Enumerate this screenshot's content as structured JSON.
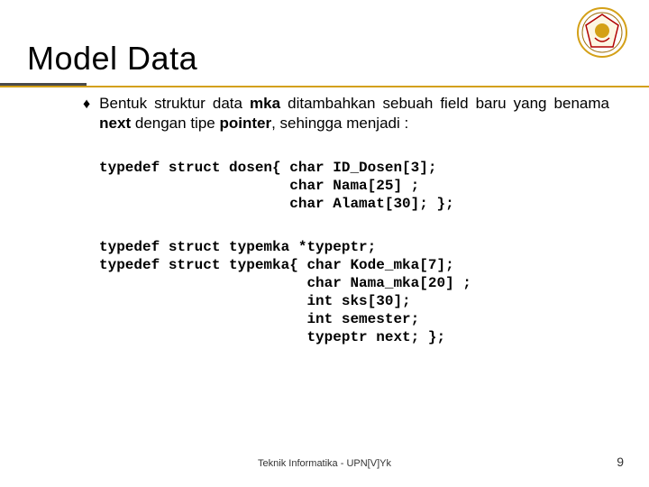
{
  "title": "Model Data",
  "bullet": {
    "marker": "♦",
    "text_parts": [
      "Bentuk struktur data ",
      "mka",
      " ditambahkan sebuah field baru yang benama ",
      "next",
      " dengan tipe ",
      "pointer",
      ", sehingga menjadi :"
    ]
  },
  "code_block_1": "typedef struct dosen{ char ID_Dosen[3];\n                      char Nama[25] ;\n                      char Alamat[30]; };",
  "code_block_2": "typedef struct typemka *typeptr;\ntypedef struct typemka{ char Kode_mka[7];\n                        char Nama_mka[20] ;\n                        int sks[30];\n                        int semester;\n                        typeptr next; };",
  "footer": "Teknik Informatika - UPN[V]Yk",
  "page": "9",
  "logo": {
    "outer_ring": "#d4a017",
    "inner": "#fff",
    "accent": "#b00000",
    "label": "university-logo"
  }
}
